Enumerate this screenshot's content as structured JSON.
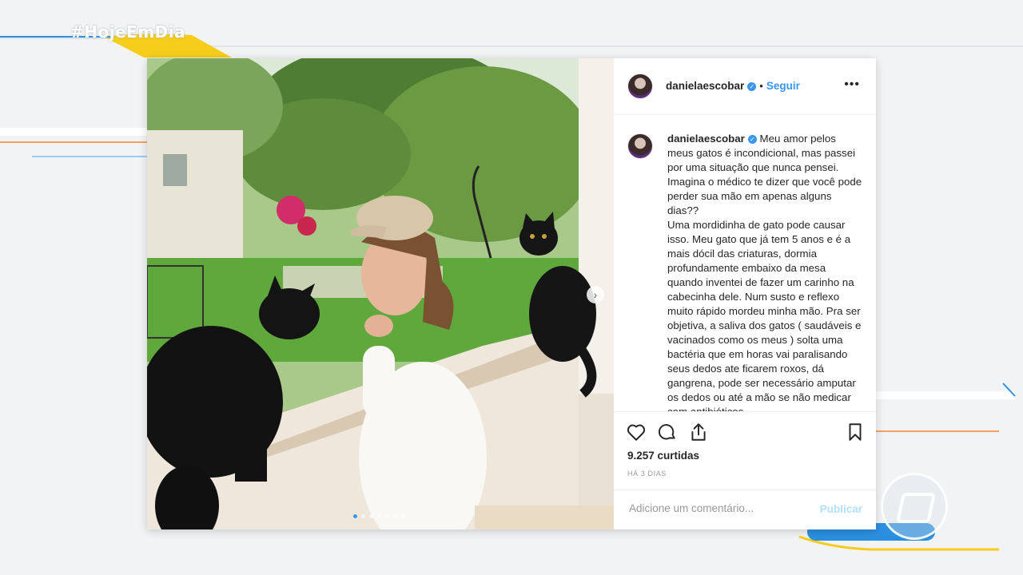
{
  "overlay": {
    "hashtag": "#HojeEmDia"
  },
  "colors": {
    "accent_blue": "#3897f0",
    "overlay_yellow": "#f6cd1a",
    "overlay_blue": "#2b8fe0",
    "overlay_orange": "#f5a25d"
  },
  "post": {
    "username": "danielaescobar",
    "separator": "•",
    "follow_label": "Seguir",
    "more_icon": "more-horizontal-icon",
    "caption": "Meu amor pelos meus gatos é incondicional, mas passei por uma situação que nunca pensei. Imagina o médico te dizer que você pode perder sua mão em apenas alguns dias??\nUma mordidinha de gato pode causar isso. Meu gato que já tem 5 anos e é a mais dócil das criaturas, dormia profundamente embaixo da mesa quando inventei de fazer um carinho na cabecinha dele. Num susto e reflexo muito rápido mordeu minha mão. Pra ser objetiva, a saliva dos gatos ( saudáveis e vacinados como os meus ) solta uma bactéria que em horas vai paralisando seus dedos ate ficarem roxos, dá gangrena, pode ser necessário amputar os dedos ou até a mão se não medicar com antibióticos",
    "likes": "9.257 curtidas",
    "date": "HÁ 3 DIAS",
    "comment_placeholder": "Adicione um comentário...",
    "publish_label": "Publicar",
    "carousel": {
      "total": 7,
      "active": 1
    }
  }
}
